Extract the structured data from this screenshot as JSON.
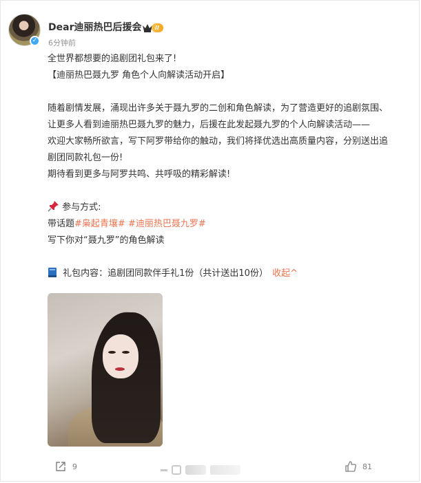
{
  "post": {
    "username": "Dear迪丽热巴后援会",
    "vip_level": "II",
    "time": "6分钟前",
    "lines": {
      "l1": "全世界都想要的追剧团礼包来了!",
      "l2": "【迪丽热巴聂九罗 角色个人向解读活动开启】",
      "l3": "随着剧情发展，涌现出许多关于聂九罗的二创和角色解读，为了营造更好的追剧氛围、",
      "l4": "让更多人看到迪丽热巴聂九罗的魅力，后援在此发起聂九罗的个人向解读活动——",
      "l5": "欢迎大家畅所欲言，写下阿罗带给你的触动，我们将择优选出高质量内容，分别送出追",
      "l6": "剧团同款礼包一份!",
      "l7": "期待看到更多与阿罗共鸣、共呼吸的精彩解读!",
      "l8": "参与方式:",
      "l9_prefix": "带话题",
      "topic1": "#枭起青壤#",
      "topic2": "#迪丽热巴聂九罗#",
      "l10": "写下你对“聂九罗”的角色解读",
      "gift": "礼包内容：追剧团同款伴手礼1份（共计送出10份）",
      "collapse": "收起^"
    }
  },
  "footer": {
    "share_count": "9",
    "like_count": "81"
  },
  "icons": [
    "verified-icon",
    "crown-icon",
    "pushpin-icon",
    "book-icon",
    "share-icon",
    "like-icon"
  ],
  "colors": {
    "accent": "#eb7350",
    "verify": "#3fa9f5",
    "vip": "#f3a51f"
  }
}
